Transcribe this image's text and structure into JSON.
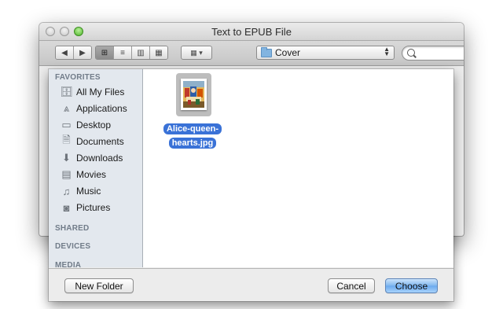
{
  "window": {
    "title": "Text to EPUB File"
  },
  "toolbar": {
    "back_icon": "chevron-left-icon",
    "forward_icon": "chevron-right-icon",
    "view_modes": [
      "icon-view-icon",
      "list-view-icon",
      "column-view-icon",
      "cover-flow-icon"
    ],
    "active_view": "icon-view-icon",
    "arrange_icon": "arrange-grid-icon",
    "path": "Cover",
    "search": {
      "value": "",
      "placeholder": ""
    }
  },
  "sidebar": {
    "sections": [
      {
        "header": "FAVORITES",
        "items": [
          {
            "label": "All My Files",
            "icon": "all-files-icon"
          },
          {
            "label": "Applications",
            "icon": "applications-icon"
          },
          {
            "label": "Desktop",
            "icon": "desktop-icon"
          },
          {
            "label": "Documents",
            "icon": "documents-icon"
          },
          {
            "label": "Downloads",
            "icon": "downloads-icon"
          },
          {
            "label": "Movies",
            "icon": "movies-icon"
          },
          {
            "label": "Music",
            "icon": "music-icon"
          },
          {
            "label": "Pictures",
            "icon": "pictures-icon"
          }
        ]
      },
      {
        "header": "SHARED",
        "items": []
      },
      {
        "header": "DEVICES",
        "items": []
      },
      {
        "header": "MEDIA",
        "items": []
      }
    ]
  },
  "files": [
    {
      "name_line1": "Alice-queen-",
      "name_line2": "hearts.jpg",
      "selected": true
    }
  ],
  "buttons": {
    "new_folder": "New Folder",
    "cancel": "Cancel",
    "choose": "Choose"
  },
  "colors": {
    "selection": "#3a72d7",
    "default_button": "#6aa9ee",
    "sidebar_bg": "#e3e8ee"
  }
}
